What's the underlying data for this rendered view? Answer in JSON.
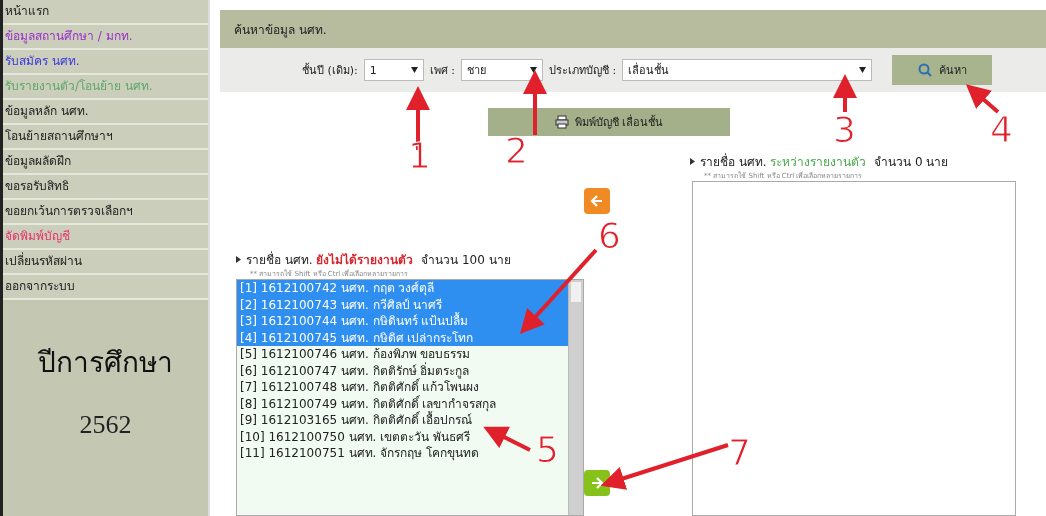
{
  "sidebar": {
    "items": [
      {
        "label": "หน้าแรก",
        "color": "#222222"
      },
      {
        "label": "ข้อมูลสถานศึกษา / มกท.",
        "color": "#9b30c8"
      },
      {
        "label": "รับสมัคร นศท.",
        "color": "#3a3adb"
      },
      {
        "label": "รับรายงานตัว/โอนย้าย นศท.",
        "color": "#5fa86a"
      },
      {
        "label": "ข้อมูลหลัก นศท.",
        "color": "#222222"
      },
      {
        "label": "โอนย้ายสถานศึกษาฯ",
        "color": "#222222"
      },
      {
        "label": "ข้อมูลผลัดฝึก",
        "color": "#222222"
      },
      {
        "label": "ขอรอรับสิทธิ",
        "color": "#222222"
      },
      {
        "label": "ขอยกเว้นการตรวจเลือกฯ",
        "color": "#222222"
      },
      {
        "label": "จัดพิมพ์บัญชี",
        "color": "#e8336a"
      },
      {
        "label": "เปลี่ยนรหัสผ่าน",
        "color": "#222222"
      },
      {
        "label": "ออกจากระบบ",
        "color": "#222222"
      }
    ],
    "year_label": "ปีการศึกษา",
    "year": "2562"
  },
  "header": "ค้นหาข้อมูล นศท.",
  "filters": [
    {
      "label": "ชั้นปี (เดิม):",
      "value": "1"
    },
    {
      "label": "เพศ :",
      "value": "ชาย"
    },
    {
      "label": "ประเภทบัญชี :",
      "value": "เลื่อนชั้น"
    }
  ],
  "search_button": "ค้นหา",
  "print_button": "พิมพ์บัญชี เลื่อนชั้น",
  "left_list": {
    "prefix": "รายชื่อ นศท.",
    "status": "ยังไม่ได้รายงานตัว",
    "count": "จำนวน 100 นาย",
    "hint": "** สามารถใช้ Shift หรือ Ctrl เพื่อเลือกหลายรายการ",
    "rows": [
      {
        "text": "[1] 1612100742 นศท. กฤต วงศ์ตุลี",
        "selected": true
      },
      {
        "text": "[2] 1612100743 นศท. กวีศิลป์ นาศรี",
        "selected": true
      },
      {
        "text": "[3] 1612100744 นศท. กษิดินทร์ แป้นปลื้ม",
        "selected": true
      },
      {
        "text": "[4] 1612100745 นศท. กษิดิศ เปล่ากระโทก",
        "selected": true
      },
      {
        "text": "[5] 1612100746 นศท. ก้องพิภพ ขอบธรรม",
        "selected": false
      },
      {
        "text": "[6] 1612100747 นศท. กิตติรักษ์ อิ่มตระกูล",
        "selected": false
      },
      {
        "text": "[7] 1612100748 นศท. กิตติศักดิ์ แก้วโพนผง",
        "selected": false
      },
      {
        "text": "[8] 1612100749 นศท. กิตติศักดิ์ เลขากำจรสกุล",
        "selected": false
      },
      {
        "text": "[9] 1612103165 นศท. กิตติศักดิ์ เอื้อปกรณ์",
        "selected": false
      },
      {
        "text": "[10] 1612100750 นศท. เขตตะวัน พันธศรี",
        "selected": false
      },
      {
        "text": "[11] 1612100751 นศท. จักรกฤษ โคกขุนทด",
        "selected": false
      }
    ]
  },
  "right_list": {
    "prefix": "รายชื่อ นศท.",
    "status": "ระหว่างรายงานตัว",
    "count": "จำนวน 0 นาย",
    "hint": "** สามารถใช้ Shift หรือ Ctrl เพื่อเลือกหลายรายการ"
  },
  "annotations": [
    "1",
    "2",
    "3",
    "4",
    "5",
    "6",
    "7"
  ]
}
